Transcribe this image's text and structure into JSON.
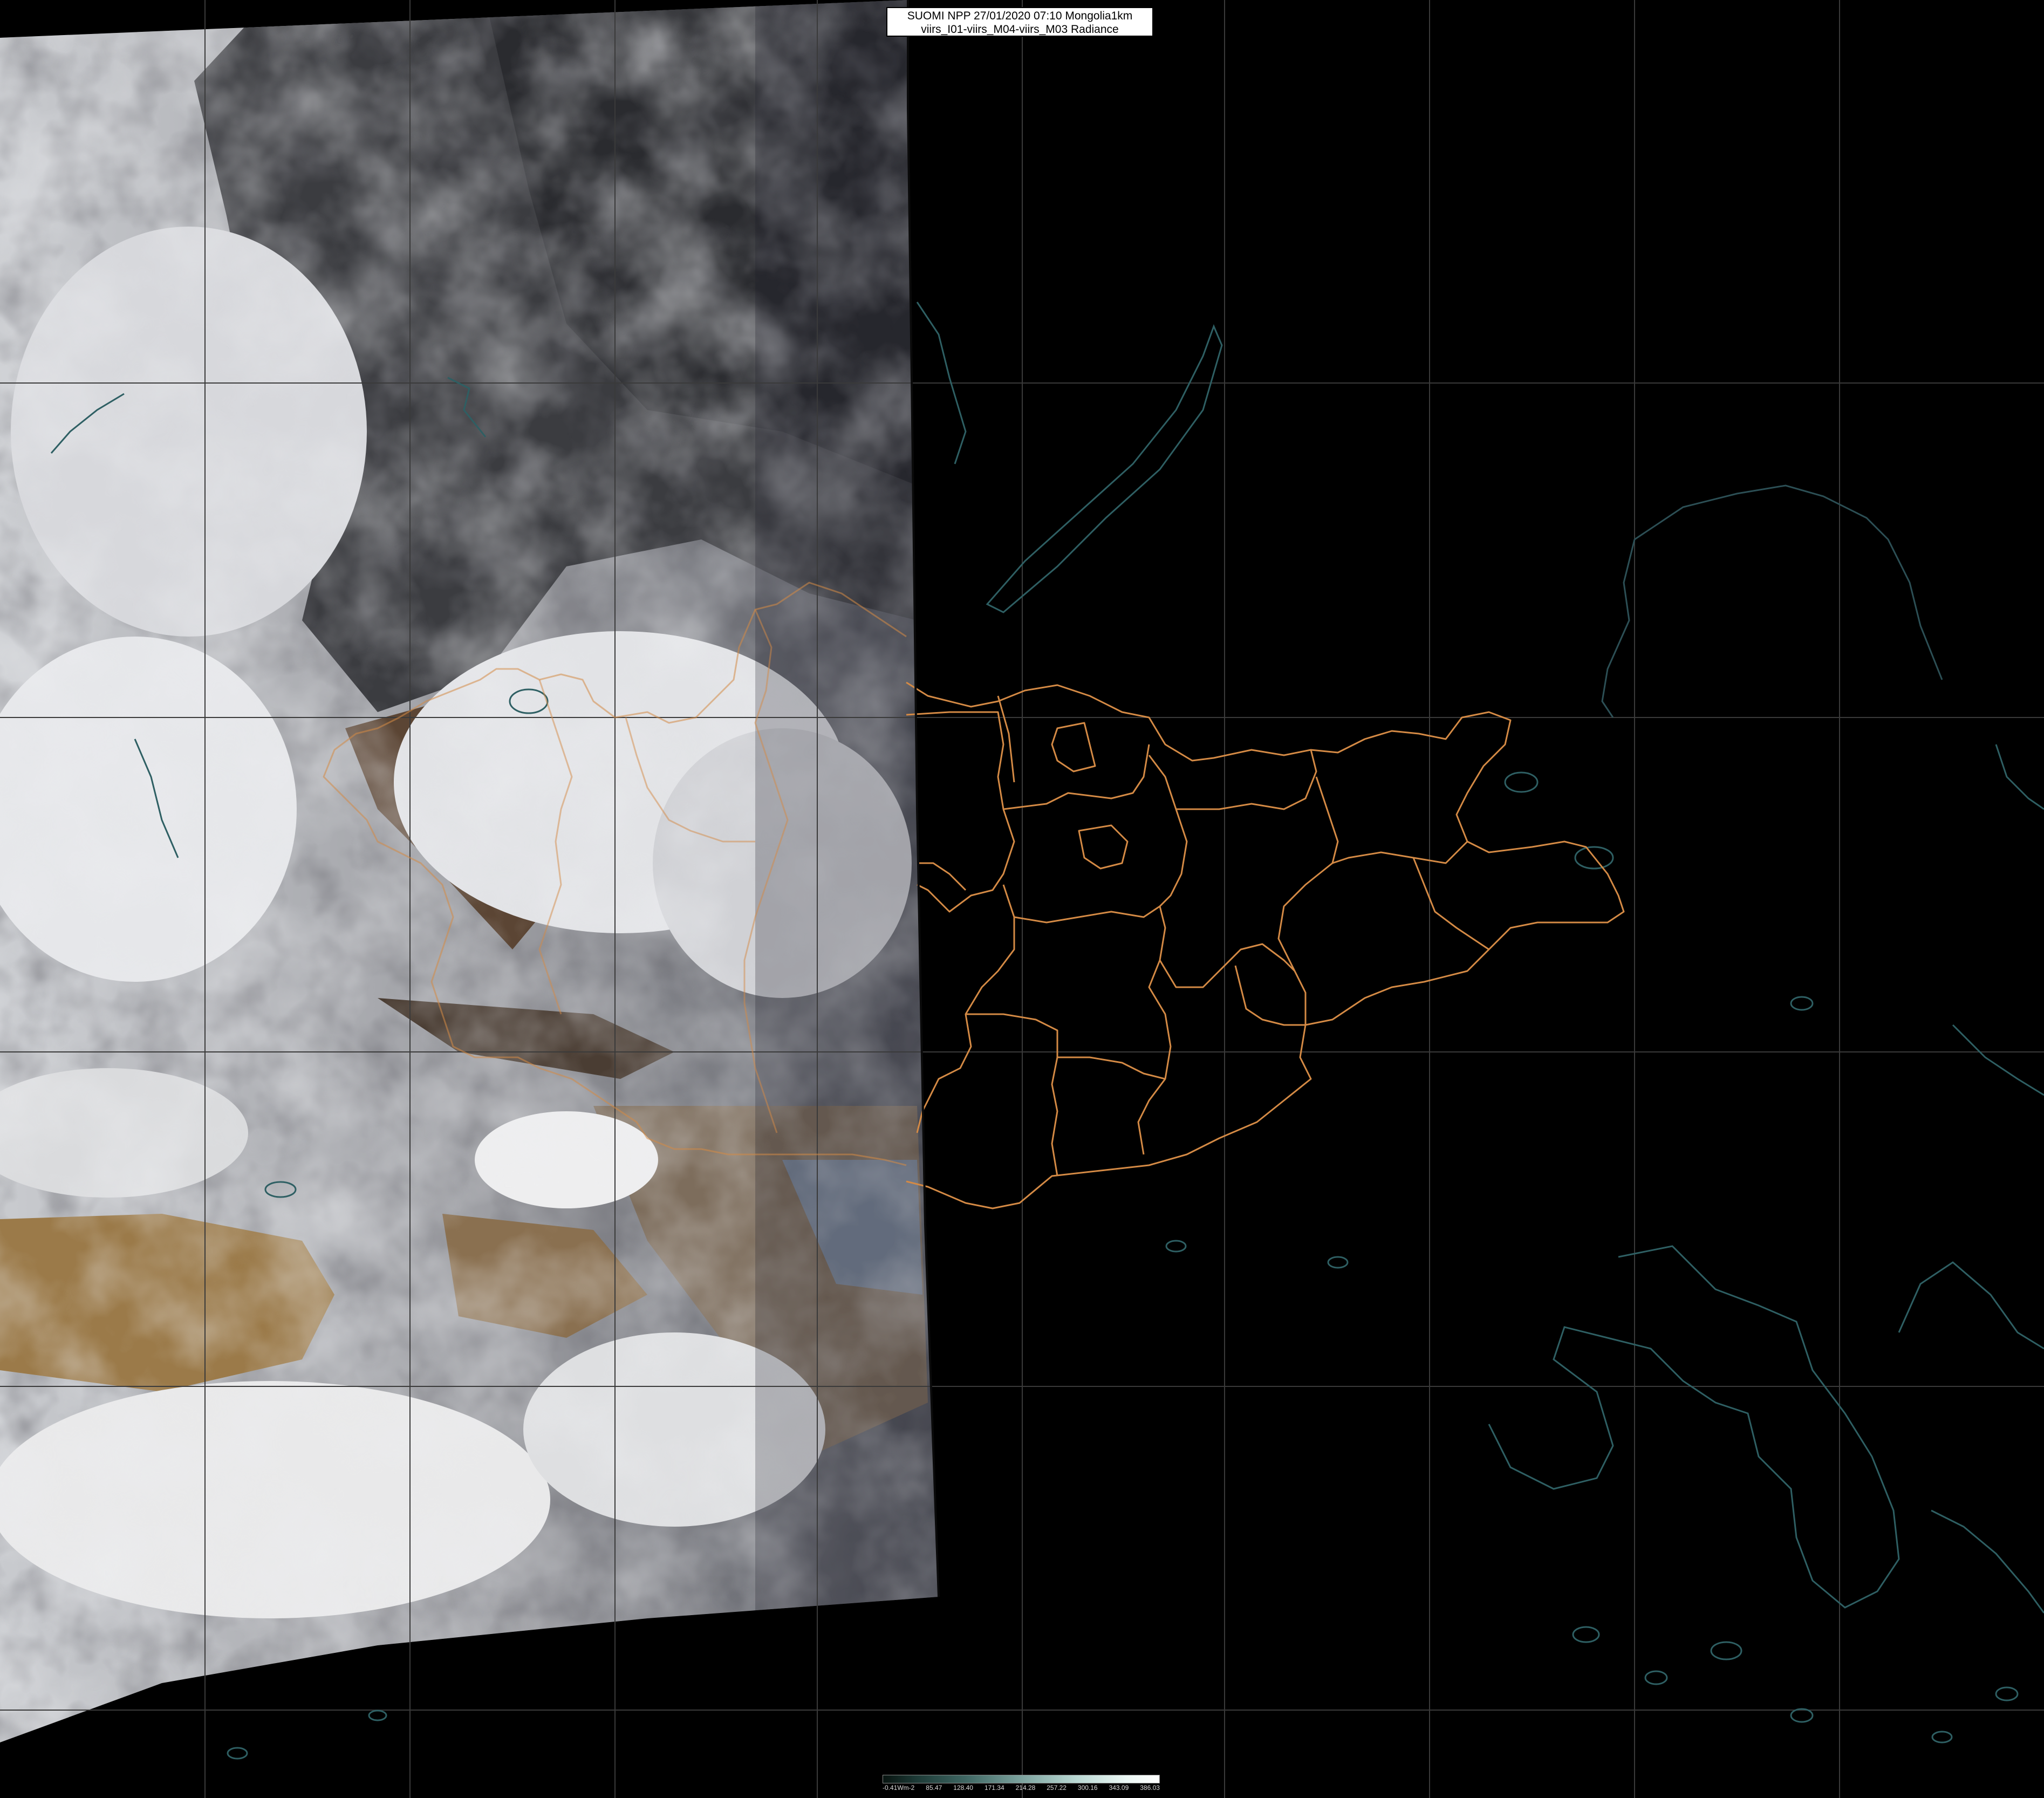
{
  "title": {
    "line1": "SUOMI NPP 27/01/2020 07:10 Mongolia1km",
    "line2": "viirs_I01-viirs_M04-viirs_M03 Radiance"
  },
  "colorbar": {
    "labels": [
      "-0.41Wm-2",
      "85.47",
      "128.40",
      "171.34",
      "214.28",
      "257.22",
      "300.16",
      "343.09",
      "386.03"
    ]
  },
  "colors": {
    "background": "#000000",
    "border_outline": "#d48a45",
    "coastline": "#2e5f63",
    "gridline": "#3a3a3a"
  }
}
